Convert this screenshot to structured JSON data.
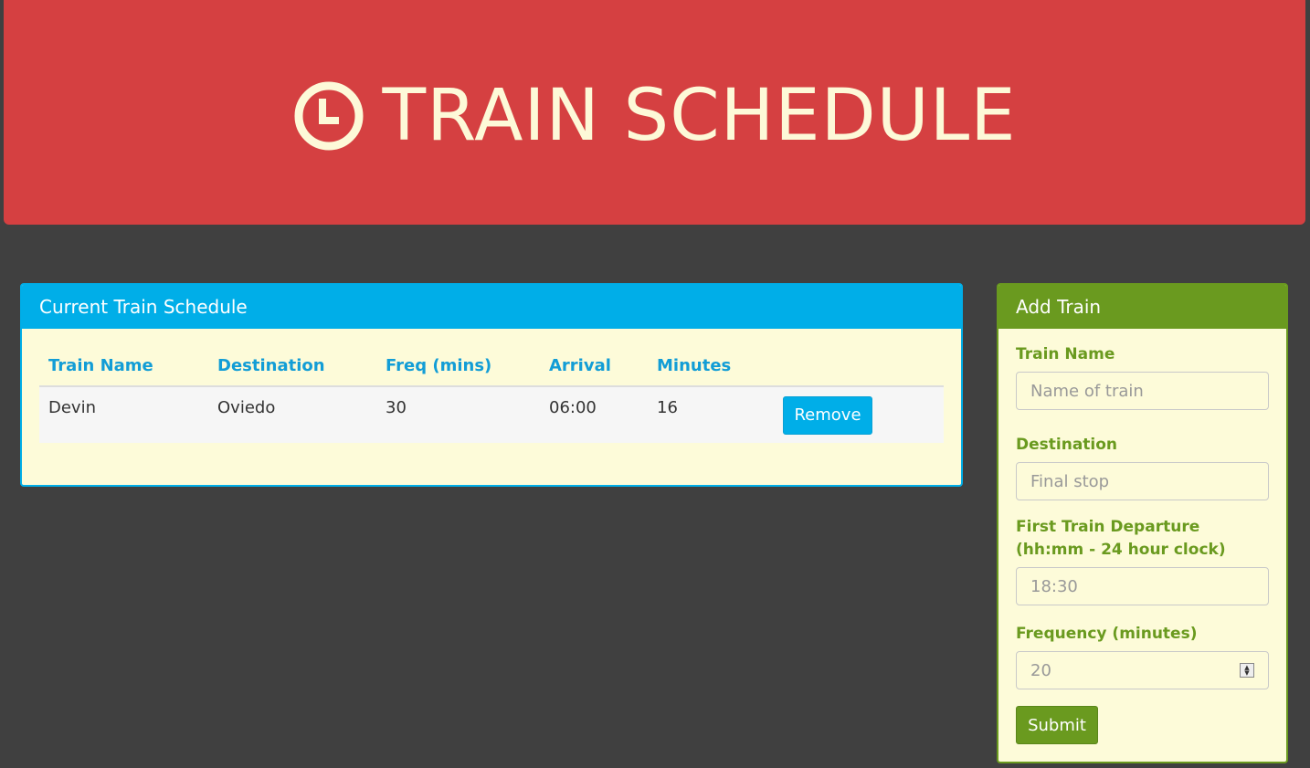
{
  "header": {
    "title": "TRAIN SCHEDULE",
    "icon": "clock-icon",
    "bg_color": "#d54041",
    "text_color": "#fdf9d8"
  },
  "schedule": {
    "heading": "Current Train Schedule",
    "accent_color": "#00aee8",
    "columns": [
      "Train Name",
      "Destination",
      "Freq (mins)",
      "Arrival",
      "Minutes"
    ],
    "rows": [
      {
        "name": "Devin",
        "destination": "Oviedo",
        "freq": "30",
        "arrival": "06:00",
        "minutes": "16",
        "remove_label": "Remove"
      }
    ]
  },
  "add_train": {
    "heading": "Add Train",
    "accent_color": "#6a9a1f",
    "fields": {
      "name": {
        "label": "Train Name",
        "placeholder": "Name of train"
      },
      "destination": {
        "label": "Destination",
        "placeholder": "Final stop"
      },
      "first_departure": {
        "label": "First Train Departure (hh:mm - 24 hour clock)",
        "placeholder": "18:30"
      },
      "frequency": {
        "label": "Frequency (minutes)",
        "placeholder": "20"
      }
    },
    "submit_label": "Submit"
  }
}
